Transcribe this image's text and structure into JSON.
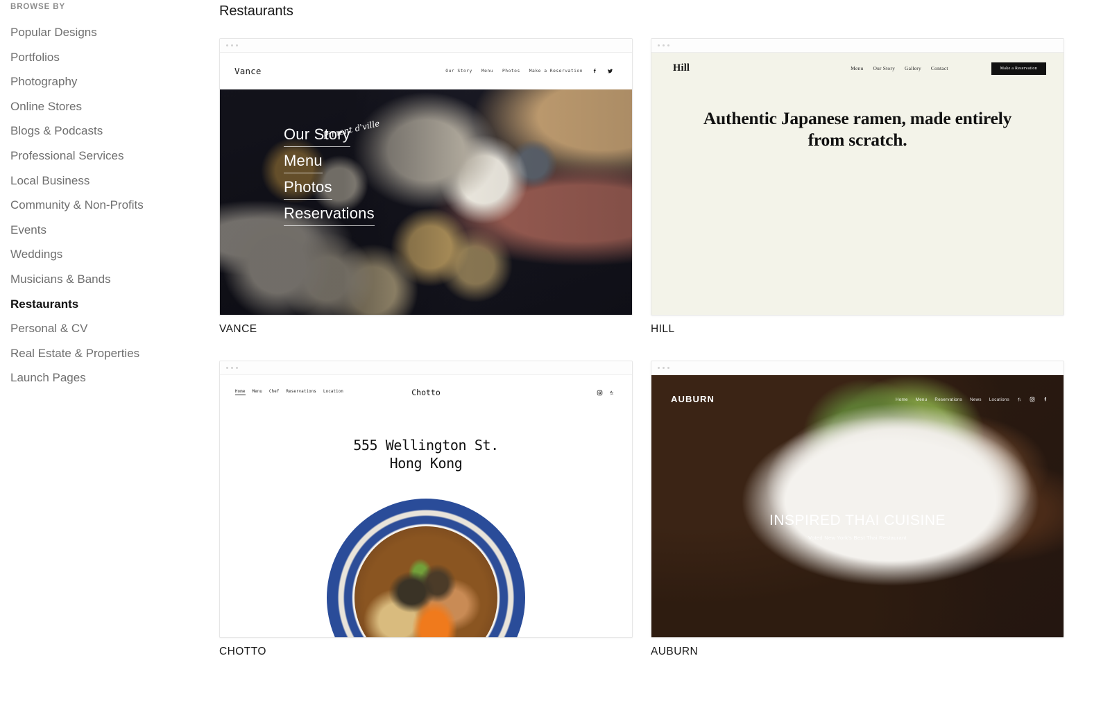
{
  "sidebar": {
    "heading": "BROWSE BY",
    "items": [
      {
        "label": "Popular Designs",
        "active": false
      },
      {
        "label": "Portfolios",
        "active": false
      },
      {
        "label": "Photography",
        "active": false
      },
      {
        "label": "Online Stores",
        "active": false
      },
      {
        "label": "Blogs & Podcasts",
        "active": false
      },
      {
        "label": "Professional Services",
        "active": false
      },
      {
        "label": "Local Business",
        "active": false
      },
      {
        "label": "Community & Non-Profits",
        "active": false
      },
      {
        "label": "Events",
        "active": false
      },
      {
        "label": "Weddings",
        "active": false
      },
      {
        "label": "Musicians & Bands",
        "active": false
      },
      {
        "label": "Restaurants",
        "active": true
      },
      {
        "label": "Personal & CV",
        "active": false
      },
      {
        "label": "Real Estate & Properties",
        "active": false
      },
      {
        "label": "Launch Pages",
        "active": false
      }
    ]
  },
  "main": {
    "section_title": "Restaurants",
    "templates": [
      {
        "caption": "VANCE",
        "logo": "Vance",
        "nav": [
          "Our Story",
          "Menu",
          "Photos",
          "Make a Reservation"
        ],
        "social": [
          "facebook-icon",
          "twitter-icon"
        ],
        "hero_links": [
          "Our Story",
          "Menu",
          "Photos",
          "Reservations"
        ],
        "handwriting": "Piment d'ville"
      },
      {
        "caption": "HILL",
        "logo": "Hill",
        "nav": [
          "Menu",
          "Our Story",
          "Gallery",
          "Contact"
        ],
        "cta": "Make a Reservation",
        "headline": "Authentic Japanese ramen, made entirely from scratch."
      },
      {
        "caption": "CHOTTO",
        "logo": "Chotto",
        "nav": [
          "Home",
          "Menu",
          "Chef",
          "Reservations",
          "Location"
        ],
        "current_nav": "Home",
        "icons": [
          "instagram-icon",
          "yelp-icon"
        ],
        "address_line1": "555 Wellington St.",
        "address_line2": "Hong Kong"
      },
      {
        "caption": "AUBURN",
        "logo": "AUBURN",
        "nav": [
          "Home",
          "Menu",
          "Reservations",
          "News",
          "Locations"
        ],
        "icons": [
          "yelp-icon",
          "instagram-icon",
          "facebook-icon"
        ],
        "title": "INSPIRED THAI CUISINE",
        "subtitle": "Voted New York's Best Thai Restaurant"
      }
    ]
  },
  "colors": {
    "accent_black": "#111111",
    "sidebar_text": "#6f6f6f",
    "hill_bg": "#f3f3e9",
    "page_bg": "#ffffff"
  }
}
